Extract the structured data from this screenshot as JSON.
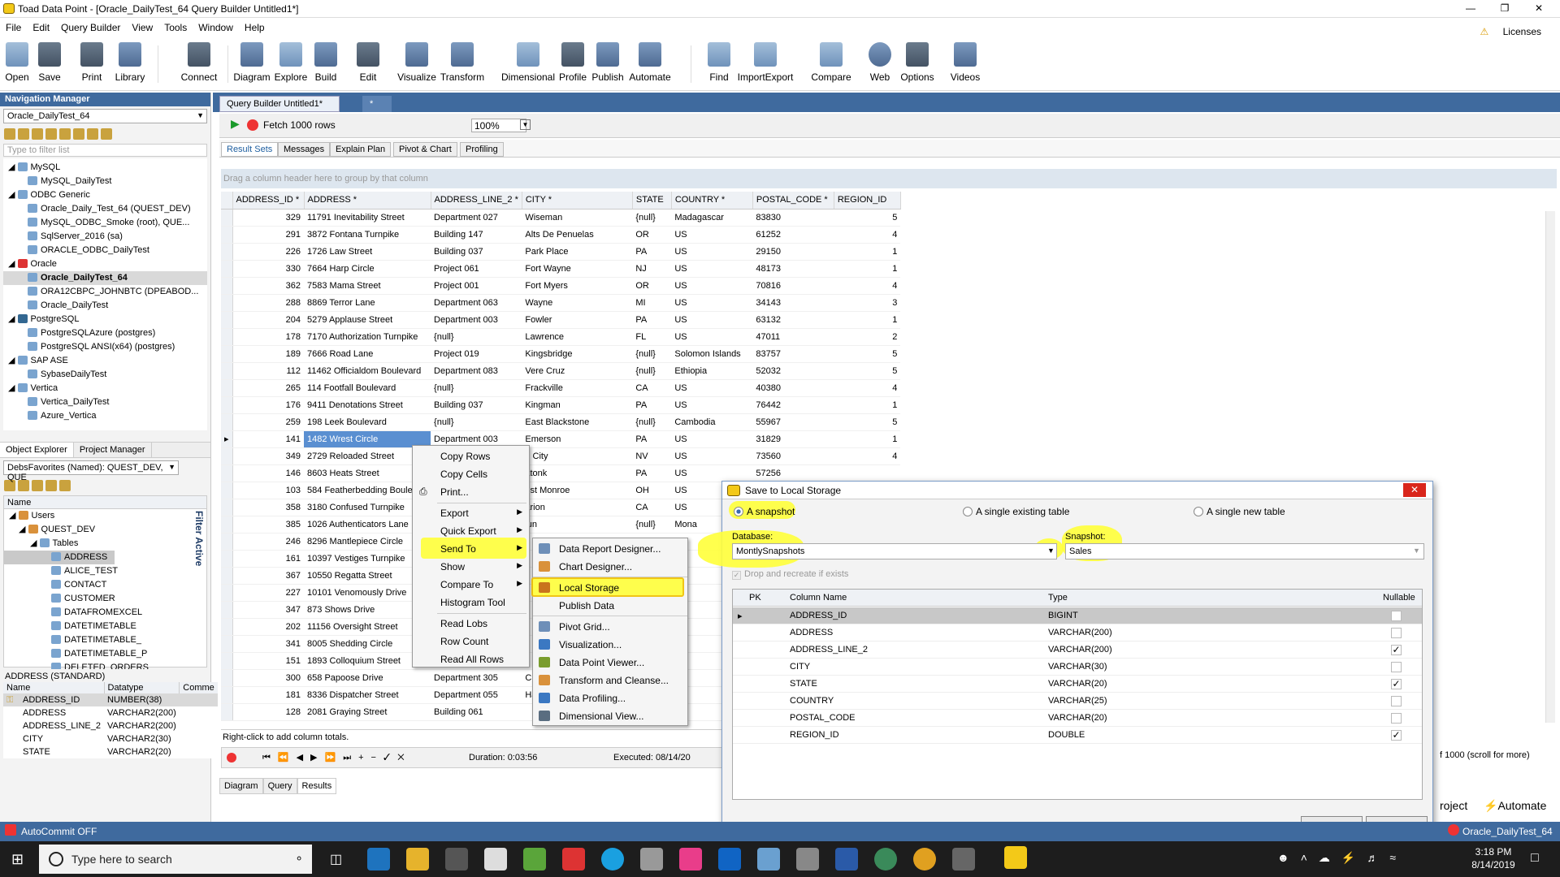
{
  "window": {
    "title": "Toad Data Point - [Oracle_DailyTest_64 Query Builder Untitled1*]"
  },
  "menu": [
    "File",
    "Edit",
    "Query Builder",
    "View",
    "Tools",
    "Window",
    "Help"
  ],
  "licenses": "Licenses",
  "toolbar": [
    "Open",
    "Save",
    "Print",
    "Library",
    "Connect",
    "Diagram",
    "Explore",
    "Build",
    "Edit",
    "Visualize",
    "Transform",
    "Dimensional",
    "Profile",
    "Publish",
    "Automate",
    "Find",
    "ImportExport",
    "Compare",
    "Web",
    "Options",
    "Videos"
  ],
  "nav": {
    "title": "Navigation Manager",
    "connection": "Oracle_DailyTest_64",
    "filter_placeholder": "Type to filter list",
    "tree": [
      "MySQL",
      "MySQL_DailyTest",
      "ODBC Generic",
      "Oracle_Daily_Test_64 (QUEST_DEV)",
      "MySQL_ODBC_Smoke (root), QUE...",
      "SqlServer_2016 (sa)",
      "ORACLE_ODBC_DailyTest",
      "Oracle",
      "Oracle_DailyTest_64",
      "ORA12CBPC_JOHNBTC (DPEABOD...",
      "Oracle_DailyTest",
      "PostgreSQL",
      "PostgreSQLAzure (postgres)",
      "PostgreSQL ANSI(x64) (postgres)",
      "SAP ASE",
      "SybaseDailyTest",
      "Vertica",
      "Vertica_DailyTest",
      "Azure_Vertica"
    ]
  },
  "objexp": {
    "tabs": [
      "Object Explorer",
      "Project Manager"
    ],
    "favorites": "DebsFavorites (Named): QUEST_DEV, QUE",
    "name_header": "Name",
    "filter_active": "Filter Active",
    "tree": [
      "Users",
      "QUEST_DEV",
      "Tables",
      "ADDRESS",
      "ALICE_TEST",
      "CONTACT",
      "CUSTOMER",
      "DATAFROMEXCEL",
      "DATETIMETABLE",
      "DATETIMETABLE_",
      "DATETIMETABLE_P",
      "DELETED_ORDERS"
    ],
    "props_title": "ADDRESS (STANDARD)",
    "props_headers": [
      "Name",
      "Datatype",
      "Comme"
    ],
    "props": [
      [
        "ADDRESS_ID",
        "NUMBER(38)"
      ],
      [
        "ADDRESS",
        "VARCHAR2(200)"
      ],
      [
        "ADDRESS_LINE_2",
        "VARCHAR2(200)"
      ],
      [
        "CITY",
        "VARCHAR2(30)"
      ],
      [
        "STATE",
        "VARCHAR2(20)"
      ]
    ]
  },
  "doc_tabs": [
    "Query Builder Untitled1*",
    "*"
  ],
  "query_toolbar": {
    "fetch": "Fetch 1000 rows",
    "zoom": "100%"
  },
  "result_tabs": [
    "Result Sets",
    "Messages",
    "Explain Plan",
    "Pivot & Chart",
    "Profiling"
  ],
  "group_hint": "Drag a column header here to group by that column",
  "grid": {
    "columns": [
      "ADDRESS_ID",
      "ADDRESS",
      "ADDRESS_LINE_2",
      "CITY",
      "STATE",
      "COUNTRY",
      "POSTAL_CODE",
      "REGION_ID"
    ],
    "rows": [
      [
        "329",
        "11791 Inevitability Street",
        "Department 027",
        "Wiseman",
        "{null}",
        "Madagascar",
        "83830",
        "5"
      ],
      [
        "291",
        "3872 Fontana Turnpike",
        "Building 147",
        "Alts De Penuelas",
        "OR",
        "US",
        "61252",
        "4"
      ],
      [
        "226",
        "1726 Law Street",
        "Building 037",
        "Park Place",
        "PA",
        "US",
        "29150",
        "1"
      ],
      [
        "330",
        "7664 Harp Circle",
        "Project 061",
        "Fort Wayne",
        "NJ",
        "US",
        "48173",
        "1"
      ],
      [
        "362",
        "7583 Mama Street",
        "Project 001",
        "Fort Myers",
        "OR",
        "US",
        "70816",
        "4"
      ],
      [
        "288",
        "8869 Terror Lane",
        "Department 063",
        "Wayne",
        "MI",
        "US",
        "34143",
        "3"
      ],
      [
        "204",
        "5279 Applause Street",
        "Department 003",
        "Fowler",
        "PA",
        "US",
        "63132",
        "1"
      ],
      [
        "178",
        "7170 Authorization Turnpike",
        "{null}",
        "Lawrence",
        "FL",
        "US",
        "47011",
        "2"
      ],
      [
        "189",
        "7666 Road Lane",
        "Project 019",
        "Kingsbridge",
        "{null}",
        "Solomon Islands",
        "83757",
        "5"
      ],
      [
        "112",
        "11462 Officialdom Boulevard",
        "Department 083",
        "Vere Cruz",
        "{null}",
        "Ethiopia",
        "52032",
        "5"
      ],
      [
        "265",
        "114 Footfall Boulevard",
        "{null}",
        "Frackville",
        "CA",
        "US",
        "40380",
        "4"
      ],
      [
        "176",
        "9411 Denotations Street",
        "Building 037",
        "Kingman",
        "PA",
        "US",
        "76442",
        "1"
      ],
      [
        "259",
        "198 Leek Boulevard",
        "{null}",
        "East Blackstone",
        "{null}",
        "Cambodia",
        "55967",
        "5"
      ],
      [
        "141",
        "1482 Wrest Circle",
        "Department 003",
        "Emerson",
        "PA",
        "US",
        "31829",
        "1"
      ],
      [
        "349",
        "2729 Reloaded Street",
        "",
        "n City",
        "NV",
        "US",
        "73560",
        "4"
      ],
      [
        "146",
        "8603 Heats Street",
        "",
        "atonk",
        "PA",
        "US",
        "57256",
        ""
      ],
      [
        "103",
        "584 Featherbedding Boule",
        "",
        "est Monroe",
        "OH",
        "US",
        "",
        ""
      ],
      [
        "358",
        "3180 Confused Turnpike",
        "",
        "arion",
        "CA",
        "US",
        "",
        ""
      ],
      [
        "385",
        "1026 Authenticators Lane",
        "",
        "lun",
        "{null}",
        "Mona",
        "",
        ""
      ],
      [
        "246",
        "8296 Mantlepiece Circle",
        "",
        "",
        "",
        "",
        "",
        ""
      ],
      [
        "161",
        "10397 Vestiges Turnpike",
        "",
        "",
        "",
        "",
        "",
        ""
      ],
      [
        "367",
        "10550 Regatta Street",
        "",
        "",
        "",
        "",
        "",
        ""
      ],
      [
        "227",
        "10101 Venomously Drive",
        "",
        "",
        "",
        "",
        "",
        ""
      ],
      [
        "347",
        "873 Shows Drive",
        "",
        "",
        "",
        "",
        "",
        ""
      ],
      [
        "202",
        "11156 Oversight Street",
        "",
        "",
        "",
        "",
        "",
        ""
      ],
      [
        "341",
        "8005 Shedding Circle",
        "",
        "",
        "",
        "",
        "",
        ""
      ],
      [
        "151",
        "1893 Colloquium Street",
        "",
        "",
        "",
        "",
        "",
        ""
      ],
      [
        "300",
        "658 Papoose Drive",
        "Department 305",
        "Ch",
        "",
        "",
        "",
        ""
      ],
      [
        "181",
        "8336 Dispatcher Street",
        "Department 055",
        "Ha",
        "",
        "",
        "",
        ""
      ],
      [
        "128",
        "2081 Graying Street",
        "Building 061",
        "",
        "",
        "",
        "",
        ""
      ]
    ]
  },
  "status": {
    "hint": "Right-click to add column totals.",
    "duration": "Duration: 0:03:56",
    "executed": "Executed: 08/14/20",
    "scroll": "f 1000 (scroll for more)"
  },
  "bottom_tabs": [
    "Diagram",
    "Query",
    "Results"
  ],
  "context_menu": [
    "Copy Rows",
    "Copy Cells",
    "Print...",
    "Export",
    "Quick Export",
    "Send To",
    "Show",
    "Compare To",
    "Histogram Tool",
    "Read Lobs",
    "Row Count",
    "Read All Rows"
  ],
  "submenu": [
    "Data Report Designer...",
    "Chart Designer...",
    "Local Storage",
    "Publish Data",
    "Pivot Grid...",
    "Visualization...",
    "Data Point Viewer...",
    "Transform and Cleanse...",
    "Data Profiling...",
    "Dimensional View..."
  ],
  "dialog": {
    "title": "Save to Local Storage",
    "radios": [
      "A snapshot",
      "A single existing table",
      "A single new table"
    ],
    "db_label": "Database:",
    "db_value": "MontlySnapshots",
    "snap_label": "Snapshot:",
    "snap_value": "Sales",
    "drop_option": "Drop and recreate if exists",
    "headers": [
      "PK",
      "Column Name",
      "Type",
      "Nullable"
    ],
    "rows": [
      {
        "name": "ADDRESS_ID",
        "type": "BIGINT",
        "nullable": false
      },
      {
        "name": "ADDRESS",
        "type": "VARCHAR(200)",
        "nullable": false
      },
      {
        "name": "ADDRESS_LINE_2",
        "type": "VARCHAR(200)",
        "nullable": true
      },
      {
        "name": "CITY",
        "type": "VARCHAR(30)",
        "nullable": false
      },
      {
        "name": "STATE",
        "type": "VARCHAR(20)",
        "nullable": true
      },
      {
        "name": "COUNTRY",
        "type": "VARCHAR(25)",
        "nullable": false
      },
      {
        "name": "POSTAL_CODE",
        "type": "VARCHAR(20)",
        "nullable": false
      },
      {
        "name": "REGION_ID",
        "type": "DOUBLE",
        "nullable": true
      }
    ],
    "ok": "OK",
    "cancel": "Cancel"
  },
  "bottombar": {
    "autocommit": "AutoCommit OFF",
    "right_project": "roject",
    "right_automate": "Automate",
    "conn": "Oracle_DailyTest_64"
  },
  "taskbar": {
    "search": "Type here to search",
    "time": "3:18 PM",
    "date": "8/14/2019"
  },
  "colors": {
    "accent": "#3f6a9e",
    "highlight": "#ffff3a",
    "selection": "#5a8fd1",
    "close": "#d9261c"
  }
}
